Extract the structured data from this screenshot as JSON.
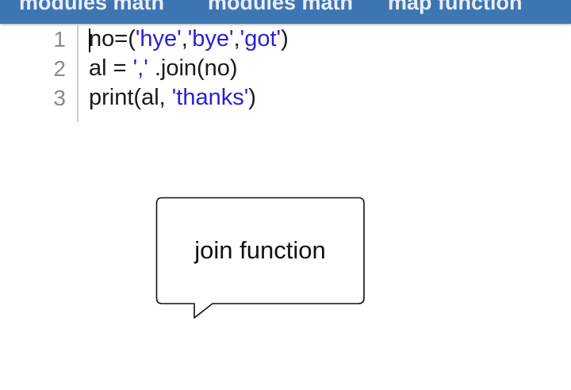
{
  "tabs": [
    {
      "label": "modules math"
    },
    {
      "label": "modules math"
    },
    {
      "label": "map function"
    }
  ],
  "editor": {
    "line_numbers": [
      "1",
      "2",
      "3"
    ],
    "lines": [
      {
        "p1": "no=(",
        "s1": "'hye'",
        "p2": ",",
        "s2": "'bye'",
        "p3": ",",
        "s3": "'got'",
        "p4": ")"
      },
      {
        "p1": "al = ",
        "s1": "','",
        "p2": " .join(no)"
      },
      {
        "p1": "print(al, ",
        "s1": "'thanks'",
        "p2": ")"
      }
    ]
  },
  "tooltip": {
    "text": "join function"
  },
  "colors": {
    "tabbar": "#3d76b3",
    "string": "#2a1fd0",
    "line_number": "#8a8a8a"
  }
}
